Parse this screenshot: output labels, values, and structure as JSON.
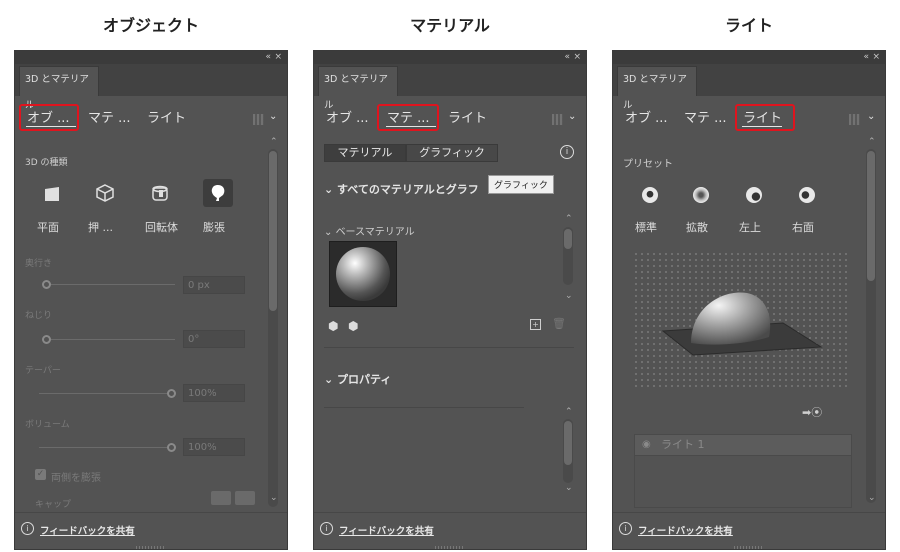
{
  "titles": {
    "object": "オブジェクト",
    "material": "マテリアル",
    "light": "ライト"
  },
  "panel": {
    "tab_label": "3D とマテリアル",
    "nav": [
      "オブ ...",
      "マテ ...",
      "ライト"
    ],
    "footer_link": "フィードバックを共有",
    "window_controls": [
      "«",
      "×"
    ]
  },
  "object_panel": {
    "section_title": "3D の種類",
    "types": [
      "平面",
      "押 ...",
      "回転体",
      "膨張"
    ],
    "depth_label": "奥行き",
    "depth_value": "0 px",
    "twist_label": "ねじり",
    "twist_value": "0°",
    "taper_label": "テーパー",
    "taper_value": "100%",
    "volume_label": "ボリューム",
    "volume_value": "100%",
    "both_sides_label": "両側を膨張",
    "cap_label": "キャップ"
  },
  "material_panel": {
    "segments": [
      "マテリアル",
      "グラフィック"
    ],
    "all_materials_label": "すべてのマテリアルとグラフ",
    "tooltip": "グラフィック",
    "base_material_label": "ベースマテリアル",
    "properties_label": "プロパティ"
  },
  "light_panel": {
    "presets_label": "プリセット",
    "presets": [
      "標準",
      "拡散",
      "左上",
      "右面"
    ],
    "light_item": "ライト 1"
  },
  "colors": {
    "panel_bg": "#535353",
    "highlight": "#e0141e"
  }
}
